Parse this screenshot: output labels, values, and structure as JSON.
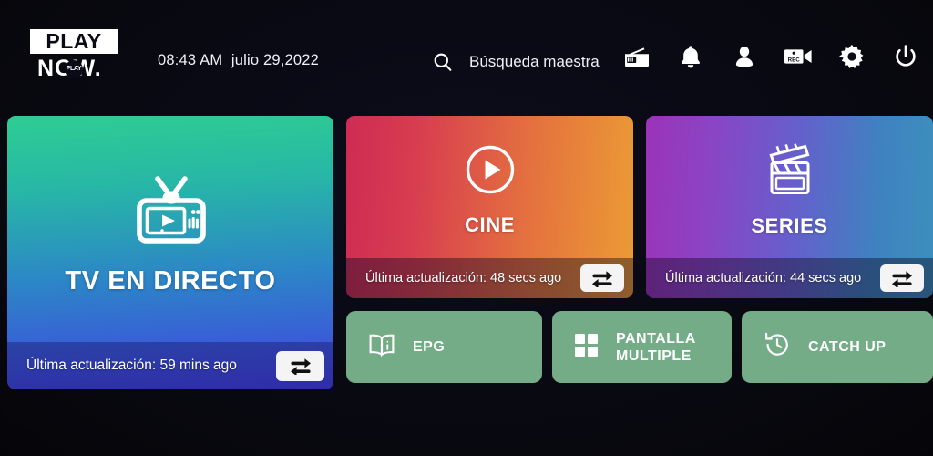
{
  "app": {
    "background_color": "#07070f"
  },
  "header": {
    "logo": {
      "line1": "PLAY",
      "line2": "NOW.",
      "badge": "PLAY"
    },
    "datetime": "08:43 AM  julio 29,2022",
    "search": {
      "icon": "search-icon",
      "label": "Búsqueda maestra"
    },
    "icons": [
      {
        "name": "radio-icon",
        "label": "Radio"
      },
      {
        "name": "bell-icon",
        "label": "Notificaciones"
      },
      {
        "name": "user-icon",
        "label": "Perfil"
      },
      {
        "name": "rec-camera-icon",
        "label": "REC"
      },
      {
        "name": "gear-icon",
        "label": "Ajustes"
      },
      {
        "name": "power-icon",
        "label": "Apagar"
      }
    ]
  },
  "cards": {
    "tv": {
      "title": "TV EN DIRECTO",
      "icon": "tv-icon",
      "footer_text": "Última actualización: 59 mins ago",
      "refresh_icon": "refresh-icon",
      "gradient_from": "#2ecd93",
      "gradient_to": "#4040dc"
    },
    "cine": {
      "title": "CINE",
      "icon": "play-circle-icon",
      "footer_text": "Última actualización: 48 secs ago",
      "refresh_icon": "refresh-icon",
      "gradient_from": "#cf2b54",
      "gradient_to": "#eb9b35"
    },
    "series": {
      "title": "SERIES",
      "icon": "clapperboard-icon",
      "footer_text": "Última actualización: 44 secs ago",
      "refresh_icon": "refresh-icon",
      "gradient_from": "#9b33b8",
      "gradient_to": "#3d8fbe"
    }
  },
  "actions": {
    "color": "#73ac87",
    "epg": {
      "label": "EPG",
      "icon": "book-info-icon"
    },
    "multiscreen": {
      "label": "PANTALLA\nMULTIPLE",
      "icon": "grid-four-icon"
    },
    "catchup": {
      "label": "CATCH UP",
      "icon": "history-clock-icon"
    }
  }
}
